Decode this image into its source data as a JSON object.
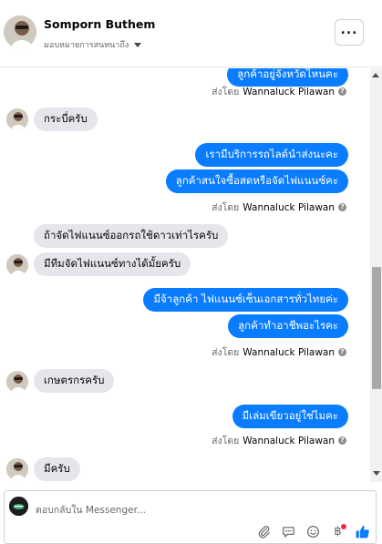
{
  "header": {
    "name": "Somporn Buthem",
    "subtitle": "มอบหมายการสนทนาถึง"
  },
  "messages": [
    {
      "type": "out",
      "text": "ลูกค้าอยู่จังหวัดไหนคะ"
    },
    {
      "type": "sent_by",
      "prefix": "ส่งโดย",
      "who": "Wannaluck Pilawan"
    },
    {
      "type": "in",
      "text": "กระบี่ครับ"
    },
    {
      "type": "out",
      "text": "เรามีบริการรถไลด์นำส่งนะคะ"
    },
    {
      "type": "out",
      "text": "ลูกค้าสนใจซื้อสดหรือจัดไฟแนนซ์คะ"
    },
    {
      "type": "sent_by",
      "prefix": "ส่งโดย",
      "who": "Wannaluck Pilawan"
    },
    {
      "type": "in",
      "text": "ถ้าจัดไฟแนนซ์ออกรถใช้ดาวเท่าไรครับ"
    },
    {
      "type": "in",
      "text": "มีทีมจัดไฟแนนซ์ทางได้มั้ยครับ"
    },
    {
      "type": "out",
      "text": "มีจ้าลูกค้า ไฟแนนซ์เซ็นเอกสารทั่วไทยค่ะ"
    },
    {
      "type": "out",
      "text": "ลูกค้าทำอาชีพอะไรคะ"
    },
    {
      "type": "sent_by",
      "prefix": "ส่งโดย",
      "who": "Wannaluck Pilawan"
    },
    {
      "type": "in",
      "text": "เกษตรกรครับ"
    },
    {
      "type": "out",
      "text": "มีเล่มเขียวอยู่ใช่ไมคะ"
    },
    {
      "type": "sent_by",
      "prefix": "ส่งโดย",
      "who": "Wannaluck Pilawan"
    },
    {
      "type": "in",
      "text": "มีครับ"
    }
  ],
  "composer": {
    "placeholder": "ตอบกลับใน Messenger...",
    "icons": [
      "paperclip-icon",
      "speech-icon",
      "smiley-icon",
      "baht-icon",
      "thumbs-up-icon"
    ]
  },
  "colors": {
    "outgoing": "#0a7cff",
    "incoming": "#e4e6eb",
    "like": "#0a7cff"
  }
}
